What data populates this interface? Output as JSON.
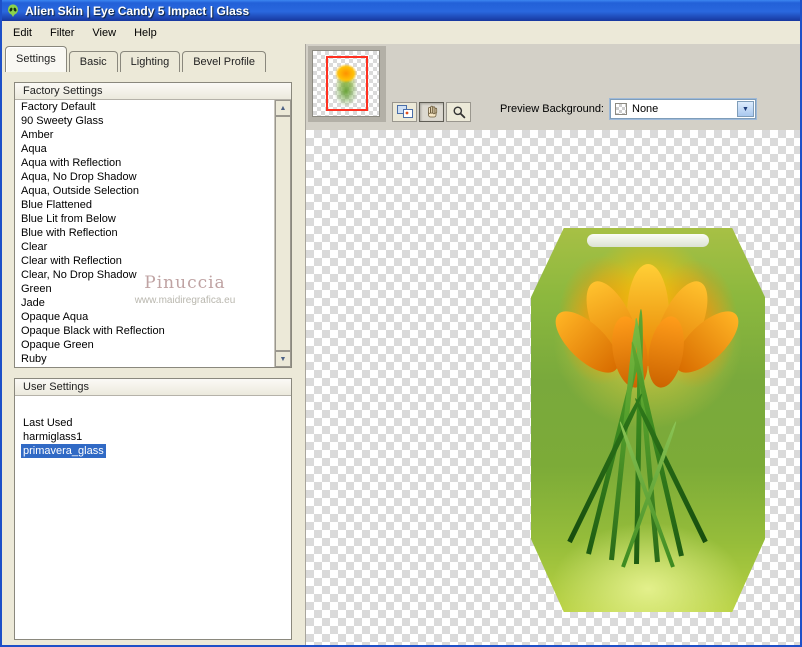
{
  "window": {
    "title": "Alien Skin | Eye Candy 5 Impact | Glass"
  },
  "menu": {
    "items": [
      {
        "label": "Edit"
      },
      {
        "label": "Filter"
      },
      {
        "label": "View"
      },
      {
        "label": "Help"
      }
    ]
  },
  "tabs": {
    "items": [
      {
        "label": "Settings",
        "active": true
      },
      {
        "label": "Basic",
        "active": false
      },
      {
        "label": "Lighting",
        "active": false
      },
      {
        "label": "Bevel Profile",
        "active": false
      }
    ]
  },
  "factory_settings": {
    "title": "Factory Settings",
    "items": [
      "Factory Default",
      "90 Sweety Glass",
      "Amber",
      "Aqua",
      "Aqua with Reflection",
      "Aqua, No Drop Shadow",
      "Aqua, Outside Selection",
      "Blue Flattened",
      "Blue Lit from Below",
      "Blue with Reflection",
      "Clear",
      "Clear with Reflection",
      "Clear, No Drop Shadow",
      "Green",
      "Jade",
      "Opaque Aqua",
      "Opaque Black with Reflection",
      "Opaque Green",
      "Ruby"
    ]
  },
  "user_settings": {
    "title": "User Settings",
    "items": [
      {
        "label": "Last Used",
        "selected": false
      },
      {
        "label": "harmiglass1",
        "selected": false
      },
      {
        "label": "primavera_glass",
        "selected": true
      }
    ]
  },
  "watermark": {
    "name": "Pinuccia",
    "url": "www.maidiregrafica.eu"
  },
  "preview_controls": {
    "background_label": "Preview Background:",
    "background_value": "None"
  },
  "icons": {
    "scroll_up": "▲",
    "scroll_down": "▼",
    "dropdown_arrow": "▼"
  },
  "colors": {
    "titlebar_blue": "#2260d8",
    "selection_blue": "#316ac5",
    "panel_beige": "#ece9d8",
    "preview_gray": "#d3d0c7",
    "checker_light": "#ffffff",
    "checker_dark": "#dadada",
    "glass_green": "#7cab38",
    "flower_orange": "#ff9200",
    "selection_box_red": "#ff3020"
  }
}
